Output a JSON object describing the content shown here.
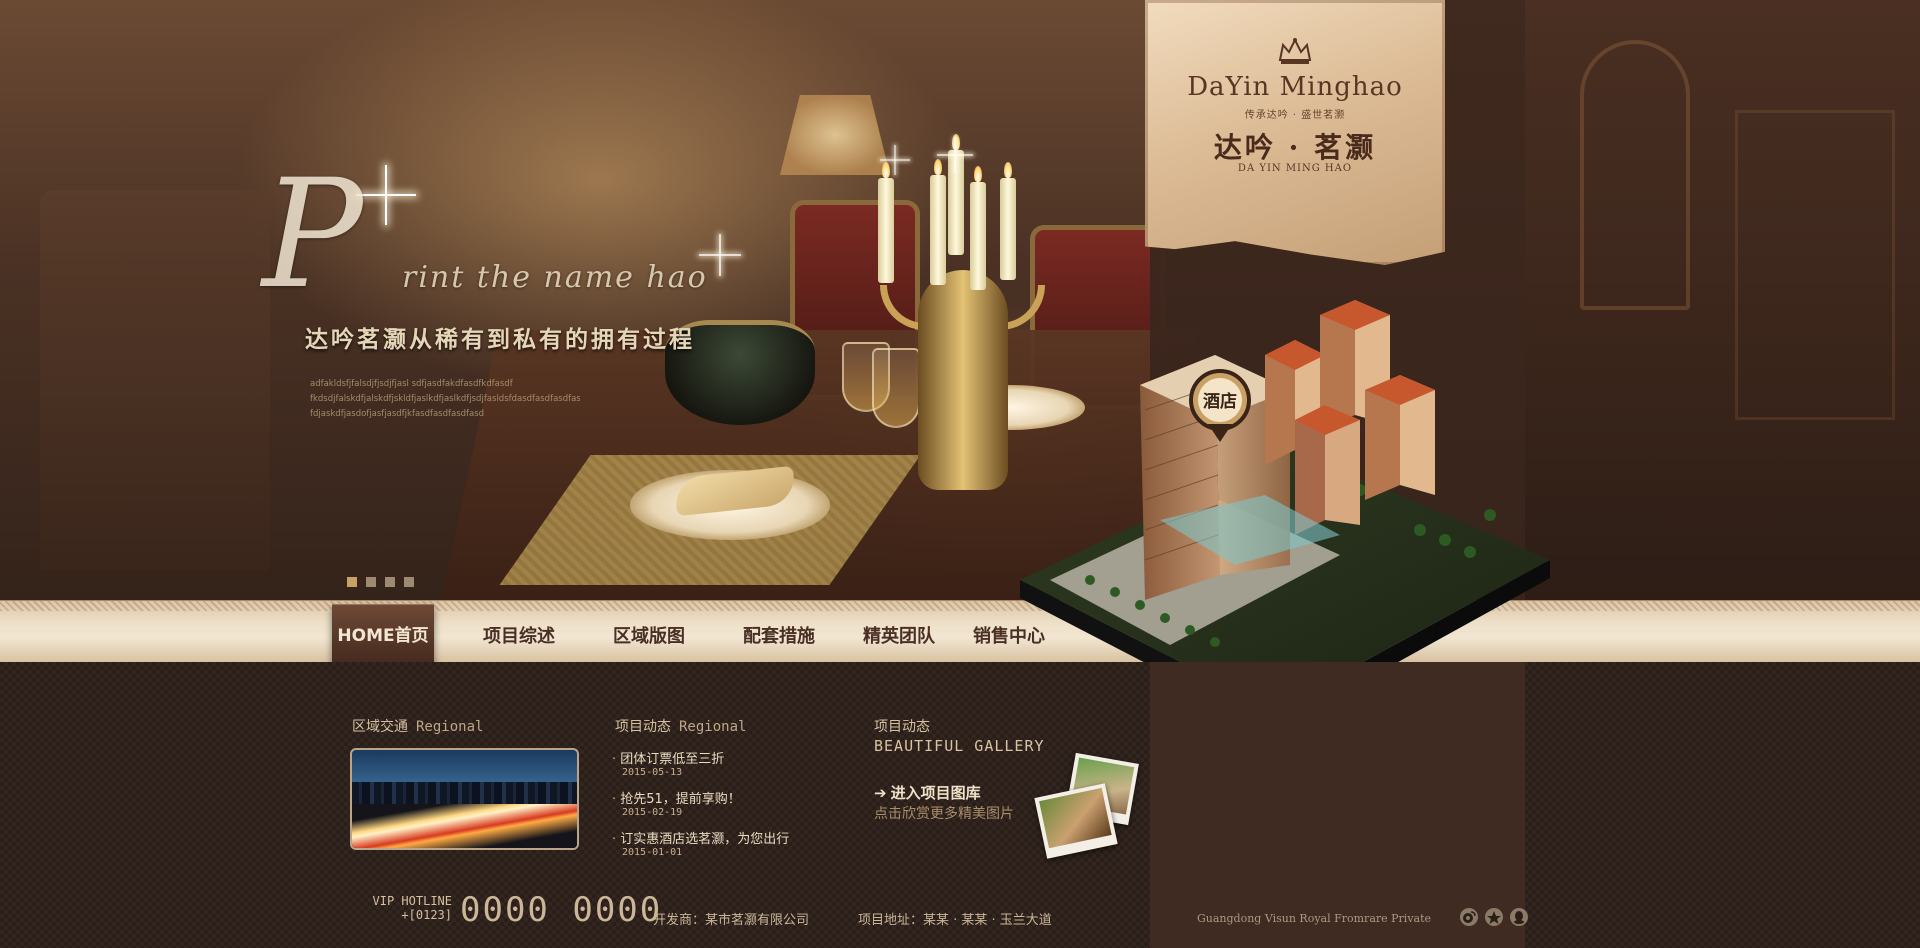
{
  "hero": {
    "script_initial": "P",
    "script_tagline": "rint the name hao",
    "slogan": "达吟茗灏从稀有到私有的拥有过程",
    "lorem_lines": [
      "adfakldsfjfalsdjfjsdjfjasl sdfjasdfakdfasdfkdfasdf",
      "fkdsdjfalskdfjalskdfjskldfjaslkdfjaslkdfjsdjfasldsfdasdfasdfasdfasdf",
      "fdjaskdfjasdofjasfjasdfjkfasdfasdfasdfasd"
    ],
    "slide_count": 4,
    "active_slide": 0
  },
  "logo": {
    "brand_en": "DaYin Minghao",
    "brand_sub": "传承达吟 · 盛世茗灏",
    "brand_cn": "达吟 · 茗灏",
    "brand_pinyin": "DA YIN MING HAO",
    "icon": "crown-icon"
  },
  "map_pin": {
    "label": "酒店"
  },
  "nav": {
    "home": "HOME首页",
    "items": [
      "项目综述",
      "区域版图",
      "配套措施",
      "精英团队",
      "销售中心"
    ]
  },
  "regional": {
    "title": "区域交通",
    "title_en": "Regional"
  },
  "news": {
    "title": "项目动态",
    "title_en": "Regional",
    "items": [
      {
        "title": "团体订票低至三折",
        "date": "2015-05-13"
      },
      {
        "title": "抢先51，提前享购！",
        "date": "2015-02-19"
      },
      {
        "title": "订实惠酒店选茗灏，为您出行",
        "date": "2015-01-01"
      }
    ]
  },
  "gallery": {
    "title": "项目动态",
    "title_en": "BEAUTIFUL  GALLERY",
    "link": "进入项目图库",
    "desc": "点击欣赏更多精美图片"
  },
  "footer": {
    "hotline_label_1": "VIP HOTLINE",
    "hotline_label_2": "+[0123]",
    "hotline_number": "0000 0000",
    "developer": "开发商：某市茗灏有限公司",
    "address": "项目地址：某某 · 某某 · 玉兰大道",
    "copyright": "Guangdong Visun Royal Fromrare Private",
    "social_icons": [
      "weibo-icon",
      "qzone-icon",
      "qq-icon"
    ]
  },
  "colors": {
    "accent_gold": "#c9a066",
    "nav_bar": "#eedfc7",
    "panel_brown": "#3f2b21",
    "text_light": "#d8c3a2"
  }
}
